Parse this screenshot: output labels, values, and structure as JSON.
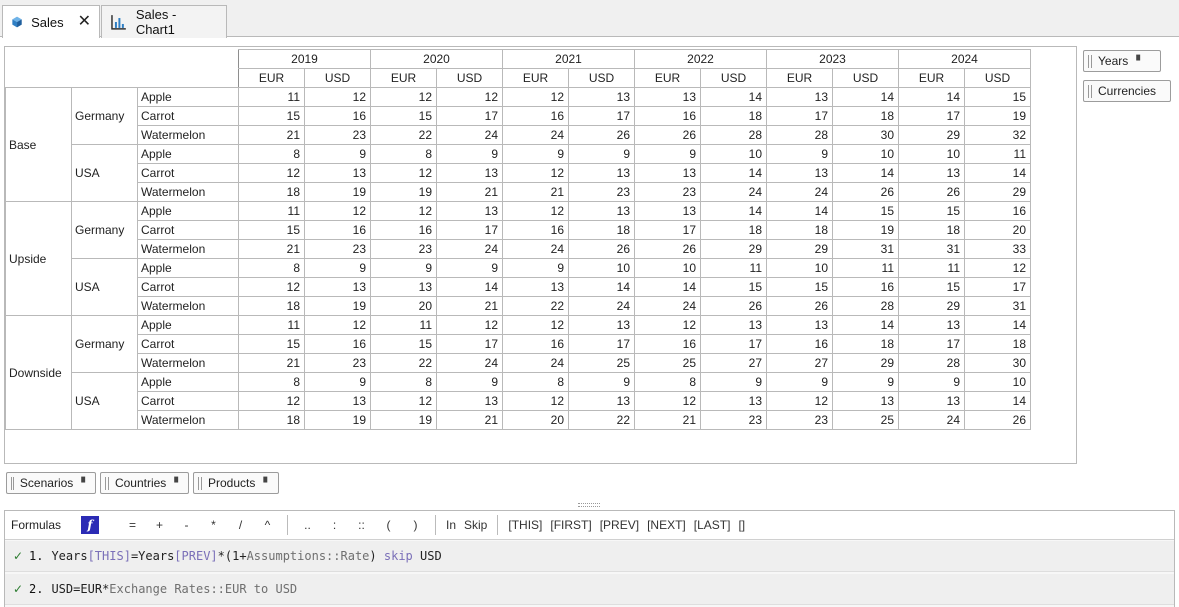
{
  "tabs": [
    {
      "label": "Sales",
      "icon": "cube-icon",
      "active": true,
      "closable": true
    },
    {
      "label": "Sales - Chart1",
      "icon": "chart-icon",
      "active": false,
      "closable": false
    }
  ],
  "grid": {
    "years": [
      "2019",
      "2020",
      "2021",
      "2022",
      "2023",
      "2024"
    ],
    "currencies": [
      "EUR",
      "USD"
    ],
    "scenarios": [
      {
        "name": "Base",
        "countries": [
          {
            "name": "Germany",
            "rows": [
              {
                "product": "Apple",
                "values": [
                  11,
                  12,
                  12,
                  12,
                  12,
                  13,
                  13,
                  14,
                  13,
                  14,
                  14,
                  15
                ]
              },
              {
                "product": "Carrot",
                "values": [
                  15,
                  16,
                  15,
                  17,
                  16,
                  17,
                  16,
                  18,
                  17,
                  18,
                  17,
                  19
                ]
              },
              {
                "product": "Watermelon",
                "values": [
                  21,
                  23,
                  22,
                  24,
                  24,
                  26,
                  26,
                  28,
                  28,
                  30,
                  29,
                  32
                ]
              }
            ]
          },
          {
            "name": "USA",
            "rows": [
              {
                "product": "Apple",
                "values": [
                  8,
                  9,
                  8,
                  9,
                  9,
                  9,
                  9,
                  10,
                  9,
                  10,
                  10,
                  11
                ]
              },
              {
                "product": "Carrot",
                "values": [
                  12,
                  13,
                  12,
                  13,
                  12,
                  13,
                  13,
                  14,
                  13,
                  14,
                  13,
                  14
                ]
              },
              {
                "product": "Watermelon",
                "values": [
                  18,
                  19,
                  19,
                  21,
                  21,
                  23,
                  23,
                  24,
                  24,
                  26,
                  26,
                  29
                ]
              }
            ]
          }
        ]
      },
      {
        "name": "Upside",
        "countries": [
          {
            "name": "Germany",
            "rows": [
              {
                "product": "Apple",
                "values": [
                  11,
                  12,
                  12,
                  13,
                  12,
                  13,
                  13,
                  14,
                  14,
                  15,
                  15,
                  16
                ]
              },
              {
                "product": "Carrot",
                "values": [
                  15,
                  16,
                  16,
                  17,
                  16,
                  18,
                  17,
                  18,
                  18,
                  19,
                  18,
                  20
                ]
              },
              {
                "product": "Watermelon",
                "values": [
                  21,
                  23,
                  23,
                  24,
                  24,
                  26,
                  26,
                  29,
                  29,
                  31,
                  31,
                  33
                ]
              }
            ]
          },
          {
            "name": "USA",
            "rows": [
              {
                "product": "Apple",
                "values": [
                  8,
                  9,
                  9,
                  9,
                  9,
                  10,
                  10,
                  11,
                  10,
                  11,
                  11,
                  12
                ]
              },
              {
                "product": "Carrot",
                "values": [
                  12,
                  13,
                  13,
                  14,
                  13,
                  14,
                  14,
                  15,
                  15,
                  16,
                  15,
                  17
                ]
              },
              {
                "product": "Watermelon",
                "values": [
                  18,
                  19,
                  20,
                  21,
                  22,
                  24,
                  24,
                  26,
                  26,
                  28,
                  29,
                  31
                ]
              }
            ]
          }
        ]
      },
      {
        "name": "Downside",
        "countries": [
          {
            "name": "Germany",
            "rows": [
              {
                "product": "Apple",
                "values": [
                  11,
                  12,
                  11,
                  12,
                  12,
                  13,
                  12,
                  13,
                  13,
                  14,
                  13,
                  14
                ]
              },
              {
                "product": "Carrot",
                "values": [
                  15,
                  16,
                  15,
                  17,
                  16,
                  17,
                  16,
                  17,
                  16,
                  18,
                  17,
                  18
                ]
              },
              {
                "product": "Watermelon",
                "values": [
                  21,
                  23,
                  22,
                  24,
                  24,
                  25,
                  25,
                  27,
                  27,
                  29,
                  28,
                  30
                ]
              }
            ]
          },
          {
            "name": "USA",
            "rows": [
              {
                "product": "Apple",
                "values": [
                  8,
                  9,
                  8,
                  9,
                  8,
                  9,
                  8,
                  9,
                  9,
                  9,
                  9,
                  10
                ]
              },
              {
                "product": "Carrot",
                "values": [
                  12,
                  13,
                  12,
                  13,
                  12,
                  13,
                  12,
                  13,
                  12,
                  13,
                  13,
                  14
                ]
              },
              {
                "product": "Watermelon",
                "values": [
                  18,
                  19,
                  19,
                  21,
                  20,
                  22,
                  21,
                  23,
                  23,
                  25,
                  24,
                  26
                ]
              }
            ]
          }
        ]
      }
    ]
  },
  "column_dims": [
    {
      "label": "Years"
    },
    {
      "label": "Currencies"
    }
  ],
  "row_dims": [
    {
      "label": "Scenarios"
    },
    {
      "label": "Countries"
    },
    {
      "label": "Products"
    }
  ],
  "formulas": {
    "label": "Formulas",
    "operators": [
      "=",
      "+",
      "-",
      "*",
      "/",
      "^"
    ],
    "range_ops": [
      "..",
      ":",
      "::",
      "(",
      ")"
    ],
    "keywords": [
      "In",
      "Skip"
    ],
    "refs": [
      "[THIS]",
      "[FIRST]",
      "[PREV]",
      "[NEXT]",
      "[LAST]",
      "[]"
    ],
    "items": [
      {
        "number": "1.",
        "tokens": [
          {
            "t": "Years",
            "c": "id"
          },
          {
            "t": "[THIS]",
            "c": "kw"
          },
          {
            "t": "=",
            "c": "id"
          },
          {
            "t": "Years",
            "c": "id"
          },
          {
            "t": "[PREV]",
            "c": "kw"
          },
          {
            "t": "*",
            "c": "id"
          },
          {
            "t": "(1+",
            "c": "id"
          },
          {
            "t": "Assumptions::Rate",
            "c": "ref"
          },
          {
            "t": ")",
            "c": "id"
          },
          {
            "t": " skip ",
            "c": "skip"
          },
          {
            "t": "USD",
            "c": "id"
          }
        ]
      },
      {
        "number": "2.",
        "tokens": [
          {
            "t": "USD",
            "c": "id"
          },
          {
            "t": "=",
            "c": "id"
          },
          {
            "t": "EUR",
            "c": "id"
          },
          {
            "t": "*",
            "c": "id"
          },
          {
            "t": "Exchange Rates::EUR to USD",
            "c": "ref"
          }
        ]
      }
    ]
  },
  "colors": {
    "check": "#2e7d32",
    "keyword": "#7a6fb8",
    "fx": "#2b2bb5",
    "border": "#b9b9b9"
  }
}
